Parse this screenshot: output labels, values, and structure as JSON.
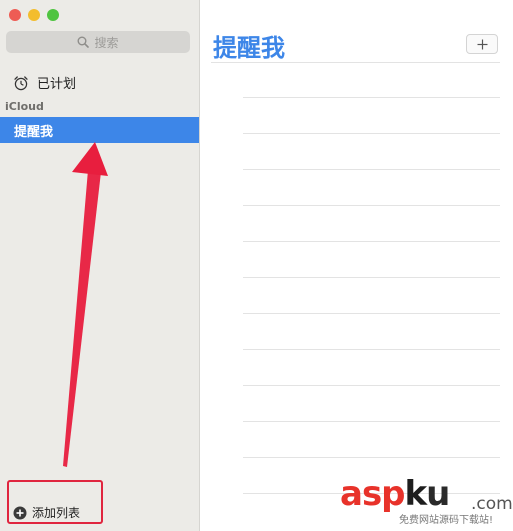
{
  "sidebar": {
    "search": {
      "placeholder": "搜索"
    },
    "scheduled": {
      "label": "已计划"
    },
    "section": {
      "label": "iCloud"
    },
    "lists": [
      {
        "label": "提醒我"
      }
    ],
    "add_list": {
      "label": "添加列表"
    }
  },
  "main": {
    "title": "提醒我"
  },
  "watermark": {
    "brand_asp": "asp",
    "brand_k": "k",
    "brand_u": "u",
    "brand_dotcom": ".com",
    "tagline": "免费网站源码下载站!"
  },
  "colors": {
    "accent": "#3d86e8",
    "sidebar_bg": "#ecebe7",
    "annotation_red": "#e0253f"
  }
}
